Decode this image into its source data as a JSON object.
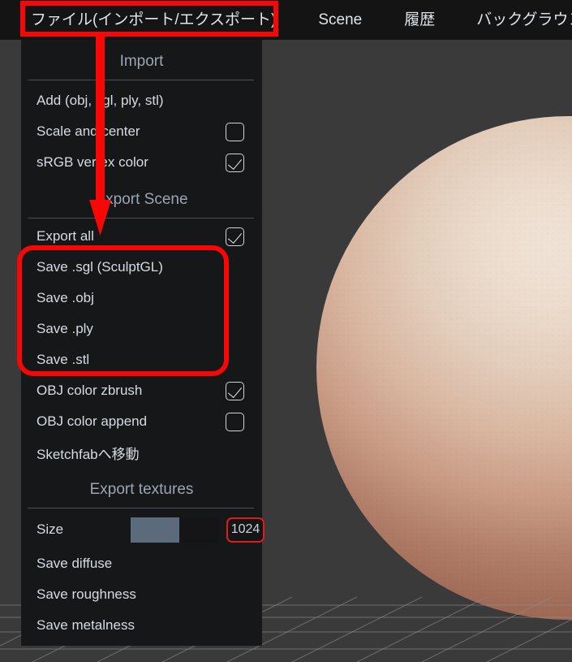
{
  "app": {
    "viewport_bg": "#3a3a3a",
    "panel_bg": "#161719",
    "topbar_bg": "#141414",
    "accent_red": "#f90606",
    "slider_fill_color": "#5c6b7b",
    "header_text_color": "#9aa6b2",
    "item_text_color": "#d5dbe2"
  },
  "topbar": {
    "items": [
      {
        "label": "ファイル(インポート/エクスポート)",
        "active": true
      },
      {
        "label": "Scene",
        "active": false
      },
      {
        "label": "履歴",
        "active": false
      },
      {
        "label": "バックグラウンド",
        "active": false
      }
    ]
  },
  "panel": {
    "sections": [
      {
        "title": "Import",
        "items": [
          {
            "label": "Add (obj, sgl, ply, stl)",
            "control": "none"
          },
          {
            "label": "Scale and center",
            "control": "checkbox",
            "checked": false
          },
          {
            "label": "sRGB vertex color",
            "control": "checkbox",
            "checked": true
          }
        ]
      },
      {
        "title": "Export Scene",
        "items": [
          {
            "label": "Export all",
            "control": "checkbox",
            "checked": true
          },
          {
            "label": "Save .sgl (SculptGL)",
            "control": "none"
          },
          {
            "label": "Save .obj",
            "control": "none"
          },
          {
            "label": "Save .ply",
            "control": "none"
          },
          {
            "label": "Save .stl",
            "control": "none"
          },
          {
            "label": "OBJ color zbrush",
            "control": "checkbox",
            "checked": true
          },
          {
            "label": "OBJ color append",
            "control": "checkbox",
            "checked": false
          },
          {
            "label": "Sketchfabへ移動",
            "control": "none"
          }
        ]
      },
      {
        "title": "Export textures",
        "size": {
          "label": "Size",
          "value": "1024",
          "slider_percent": 55
        },
        "items": [
          {
            "label": "Save diffuse",
            "control": "none"
          },
          {
            "label": "Save roughness",
            "control": "none"
          },
          {
            "label": "Save metalness",
            "control": "none"
          }
        ]
      }
    ]
  },
  "annotations": {
    "topbar_highlight": "ファイル(インポート/エクスポート)",
    "arrow": "down-arrow pointing from file menu to Export all",
    "save_group_highlight": "Save .sgl (SculptGL) / Save .obj / Save .ply / Save .stl",
    "size_value_highlight": "1024"
  }
}
